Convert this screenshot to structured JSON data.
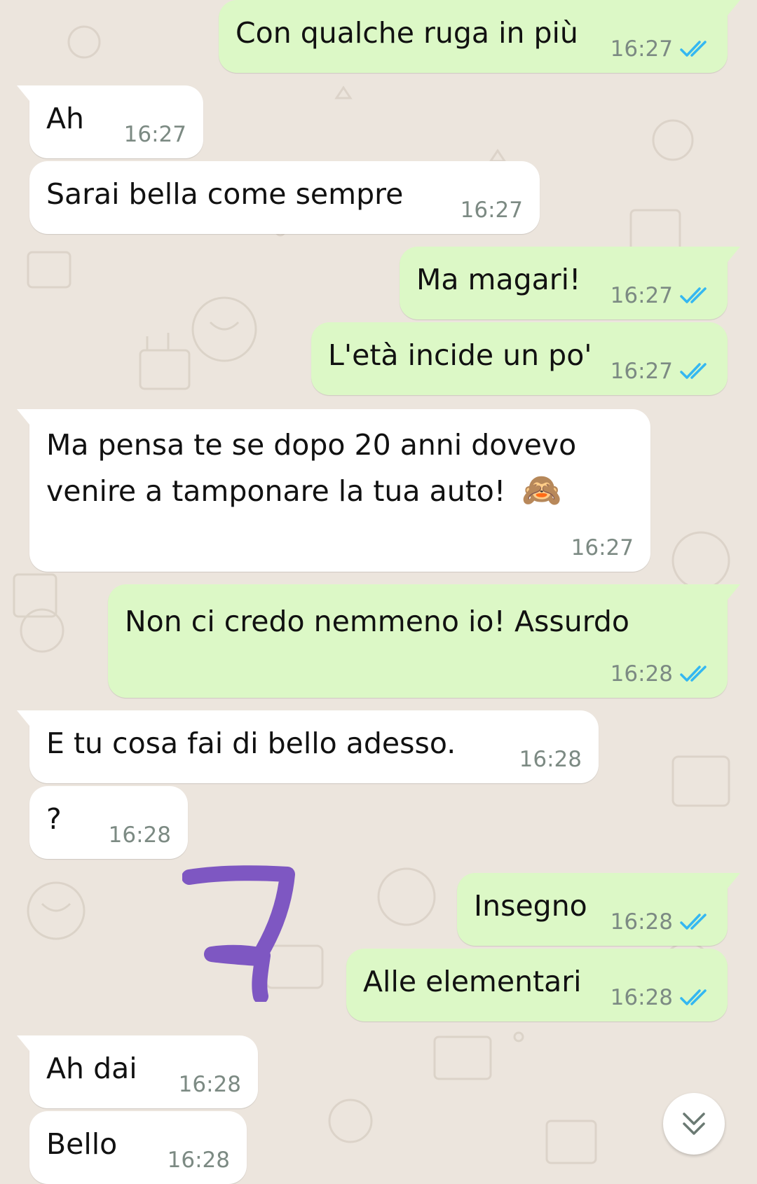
{
  "chat": {
    "messages": [
      {
        "dir": "out",
        "text": "Con qualche ruga in più",
        "time": "16:27",
        "status": "read"
      },
      {
        "dir": "in",
        "text": "Ah",
        "time": "16:27"
      },
      {
        "dir": "in",
        "text": "Sarai bella come sempre",
        "time": "16:27"
      },
      {
        "dir": "out",
        "text": "Ma magari!",
        "time": "16:27",
        "status": "read"
      },
      {
        "dir": "out",
        "text": "L'età incide un po'",
        "time": "16:27",
        "status": "read"
      },
      {
        "dir": "in",
        "line1": "Ma pensa te se dopo 20 anni dovevo",
        "line2": "venire a tamponare la tua auto!",
        "emoji": "🙈",
        "time": "16:27"
      },
      {
        "dir": "out",
        "text": "Non ci credo nemmeno io! Assurdo",
        "time": "16:28",
        "status": "read"
      },
      {
        "dir": "in",
        "text": "E tu cosa fai di bello adesso.",
        "time": "16:28"
      },
      {
        "dir": "in",
        "text": "?",
        "time": "16:28"
      },
      {
        "dir": "out",
        "text": "Insegno",
        "time": "16:28",
        "status": "read"
      },
      {
        "dir": "out",
        "text": "Alle elementari",
        "time": "16:28",
        "status": "read"
      },
      {
        "dir": "in",
        "text": "Ah dai",
        "time": "16:28"
      },
      {
        "dir": "in",
        "text": "Bello",
        "time": "16:28"
      }
    ]
  },
  "colors": {
    "background": "#ece5dd",
    "incoming_bubble": "#ffffff",
    "outgoing_bubble": "#dcf8c6",
    "read_ticks": "#34b7f1",
    "timestamp": "#7c8a83",
    "annotation": "#7e57c2"
  },
  "icons": {
    "read_receipt": "double-check-icon",
    "scroll_down": "double-chevron-down-icon"
  }
}
